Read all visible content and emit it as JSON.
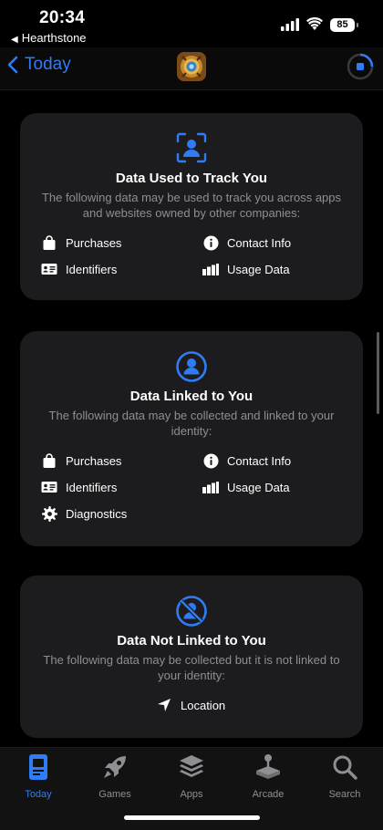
{
  "status": {
    "time": "20:34",
    "back_app": "Hearthstone",
    "battery": "85"
  },
  "nav": {
    "back_label": "Today"
  },
  "cards": [
    {
      "title": "Data Used to Track You",
      "desc": "The following data may be used to track you across apps and websites owned by other companies:",
      "items": [
        "Purchases",
        "Contact Info",
        "Identifiers",
        "Usage Data"
      ]
    },
    {
      "title": "Data Linked to You",
      "desc": "The following data may be collected and linked to your identity:",
      "items": [
        "Purchases",
        "Contact Info",
        "Identifiers",
        "Usage Data",
        "Diagnostics"
      ]
    },
    {
      "title": "Data Not Linked to You",
      "desc": "The following data may be collected but it is not linked to your identity:",
      "items": [
        "Location"
      ]
    }
  ],
  "tabs": [
    {
      "label": "Today"
    },
    {
      "label": "Games"
    },
    {
      "label": "Apps"
    },
    {
      "label": "Arcade"
    },
    {
      "label": "Search"
    }
  ],
  "colors": {
    "accent": "#2f7cf6",
    "card_bg": "#1c1c1e",
    "secondary_text": "#8e8e93"
  }
}
